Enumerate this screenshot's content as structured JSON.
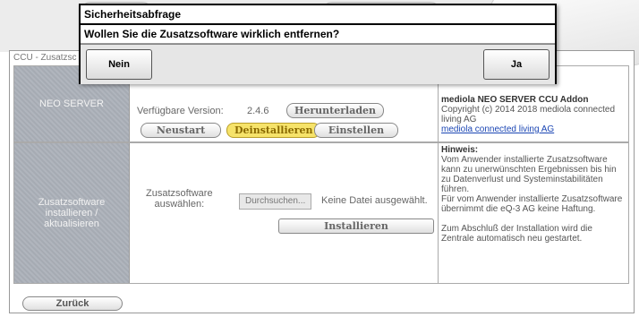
{
  "dialog": {
    "title": "Sicherheitsabfrage",
    "message": "Wollen Sie die Zusatzsoftware wirklich entfernen?",
    "no_label": "Nein",
    "yes_label": "Ja"
  },
  "panel": {
    "title": "CCU - Zusatzsc"
  },
  "neo": {
    "section_label": "NEO SERVER",
    "version_label": "Verfügbare Version:",
    "version_value": "2.4.6",
    "download_label": "Herunterladen",
    "restart_label": "Neustart",
    "uninstall_label": "Deinstallieren",
    "settings_label": "Einstellen",
    "info_title": "mediola NEO SERVER CCU Addon",
    "info_copyright": "Copyright (c) 2014 2018 mediola connected living AG",
    "info_link": "mediola connected living AG"
  },
  "addon": {
    "section_label_1": "Zusatzsoftware",
    "section_label_2": "installieren /",
    "section_label_3": "aktualisieren",
    "select_label_1": "Zusatzsoftware",
    "select_label_2": "auswählen:",
    "browse_label": "Durchsuchen...",
    "no_file_label": "Keine Datei ausgewählt.",
    "install_label": "Installieren",
    "hint_title": "Hinweis:",
    "hint_text_1": "Vom Anwender installierte Zusatzsoftware kann zu unerwünschten Ergebnissen bis hin zu Datenverlust und Systeminstabilitäten führen.",
    "hint_text_2": "Für vom Anwender installierte Zusatzsoftware übernimmt die eQ-3 AG keine Haftung.",
    "hint_text_3": "Zum Abschluß der Installation wird die Zentrale automatisch neu gestartet."
  },
  "footer": {
    "back_label": "Zurück"
  }
}
